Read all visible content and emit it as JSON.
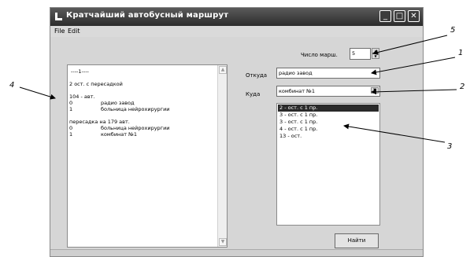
{
  "window": {
    "title": "Кратчайший автобусный маршрут"
  },
  "menu": [
    {
      "label": "File"
    },
    {
      "label": "Edit"
    }
  ],
  "memo_lines": [
    "----1----",
    "2 ост. с пересадкой",
    "104 - авт.",
    "0",
    "радио завод",
    "1",
    "больница нейрохирургии",
    "пересадка на 179 авт.",
    "0",
    "больница нейрохирургии",
    "1",
    "комбинат №1"
  ],
  "form": {
    "count_label": "Число марш.",
    "count_value": "5",
    "from_label": "Откуда",
    "from_value": "радио завод",
    "to_label": "Куда",
    "to_value": "комбинат №1",
    "routes": [
      "2 - ост. с 1 пр.",
      "3 - ост. с 1 пр.",
      "3 - ост. с 1 пр.",
      "4 - ост. с 1 пр.",
      "13 - ост."
    ],
    "selected_route_index": 0,
    "find_label": "Найти"
  },
  "callouts": {
    "c1": "1",
    "c2": "2",
    "c3": "3",
    "c4": "4",
    "c5": "5"
  },
  "colors": {
    "titlebar": "#3a3a3a",
    "selection": "#2a2a2a",
    "window_bg": "#d6d6d6"
  }
}
